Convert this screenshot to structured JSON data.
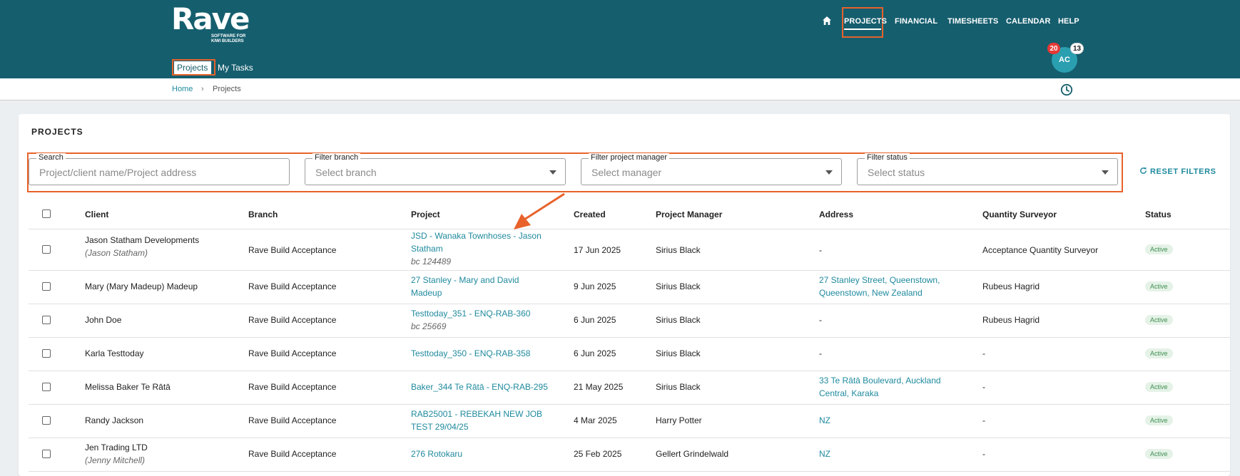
{
  "app": {
    "logo": "Rave",
    "tagline_1": "SOFTWARE FOR",
    "tagline_2": "KIWI BUILDERS"
  },
  "nav": {
    "home_icon": "home-icon",
    "items": [
      "PROJECTS",
      "FINANCIAL",
      "TIMESHEETS",
      "CALENDAR",
      "HELP"
    ]
  },
  "user": {
    "initials": "AC",
    "badge_red": "20",
    "badge_white": "13"
  },
  "subtabs": [
    "Projects",
    "My Tasks"
  ],
  "breadcrumb": [
    "Home",
    "Projects"
  ],
  "page": {
    "title": "PROJECTS"
  },
  "filters": {
    "search_label": "Search",
    "search_placeholder": "Project/client name/Project address",
    "branch_label": "Filter branch",
    "branch_placeholder": "Select branch",
    "manager_label": "Filter project manager",
    "manager_placeholder": "Select manager",
    "status_label": "Filter status",
    "status_placeholder": "Select status",
    "reset": "RESET FILTERS"
  },
  "table": {
    "headers": [
      "Client",
      "Branch",
      "Project",
      "Created",
      "Project Manager",
      "Address",
      "Quantity Surveyor",
      "Status"
    ],
    "rows": [
      {
        "client": "Jason Statham Developments",
        "client_sub": "(Jason Statham)",
        "branch": "Rave Build Acceptance",
        "project_1": "JSD - Wanaka Townhoses - Jason",
        "project_2": "Statham",
        "project_sub": "bc 124489",
        "created": "17 Jun 2025",
        "manager": "Sirius Black",
        "address_1": "-",
        "address_2": "",
        "surveyor": "Acceptance Quantity Surveyor",
        "status": "Active"
      },
      {
        "client": "Mary (Mary Madeup) Madeup",
        "client_sub": "",
        "branch": "Rave Build Acceptance",
        "project_1": "27 Stanley - Mary and David",
        "project_2": "Madeup",
        "project_sub": "",
        "created": "9 Jun 2025",
        "manager": "Sirius Black",
        "address_1": "27 Stanley Street, Queenstown,",
        "address_2": "Queenstown, New Zealand",
        "surveyor": "Rubeus Hagrid",
        "status": "Active"
      },
      {
        "client": "John Doe",
        "client_sub": "",
        "branch": "Rave Build Acceptance",
        "project_1": "Testtoday_351 - ENQ-RAB-360",
        "project_2": "",
        "project_sub": "bc 25669",
        "created": "6 Jun 2025",
        "manager": "Sirius Black",
        "address_1": "-",
        "address_2": "",
        "surveyor": "Rubeus Hagrid",
        "status": "Active"
      },
      {
        "client": "Karla Testtoday",
        "client_sub": "",
        "branch": "Rave Build Acceptance",
        "project_1": "Testtoday_350 - ENQ-RAB-358",
        "project_2": "",
        "project_sub": "",
        "created": "6 Jun 2025",
        "manager": "Sirius Black",
        "address_1": "-",
        "address_2": "",
        "surveyor": "-",
        "status": "Active"
      },
      {
        "client": "Melissa Baker Te Rātā",
        "client_sub": "",
        "branch": "Rave Build Acceptance",
        "project_1": "Baker_344 Te Rātā - ENQ-RAB-295",
        "project_2": "",
        "project_sub": "",
        "created": "21 May 2025",
        "manager": "Sirius Black",
        "address_1": "33 Te Rātā Boulevard, Auckland",
        "address_2": "Central, Karaka",
        "surveyor": "-",
        "status": "Active"
      },
      {
        "client": "Randy Jackson",
        "client_sub": "",
        "branch": "Rave Build Acceptance",
        "project_1": "RAB25001 - REBEKAH NEW JOB",
        "project_2": "TEST 29/04/25",
        "project_sub": "",
        "created": "4 Mar 2025",
        "manager": "Harry Potter",
        "address_1": "NZ",
        "address_2": "",
        "surveyor": "-",
        "status": "Active"
      },
      {
        "client": "Jen Trading LTD",
        "client_sub": "(Jenny Mitchell)",
        "branch": "Rave Build Acceptance",
        "project_1": "276 Rotokaru",
        "project_2": "",
        "project_sub": "",
        "created": "25 Feb 2025",
        "manager": "Gellert Grindelwald",
        "address_1": "NZ",
        "address_2": "",
        "surveyor": "-",
        "status": "Active"
      }
    ]
  },
  "colors": {
    "header_bg": "#155e6e",
    "accent": "#1f8a9e",
    "highlight": "#e8622a",
    "status_green": "#3f8f52"
  }
}
